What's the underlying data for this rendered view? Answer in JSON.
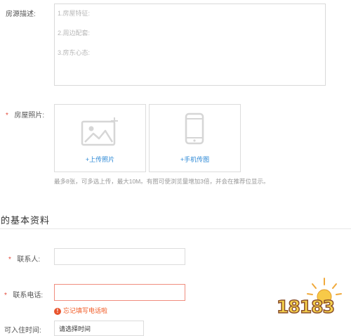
{
  "description": {
    "label": "房源描述:",
    "placeholder_lines": [
      "1.房屋特征:",
      "2.周边配套:",
      "3.房东心态:"
    ]
  },
  "photos": {
    "label": "房屋照片:",
    "upload_label": "+上传照片",
    "phone_label": "+手机传图",
    "hint": "最多8张，可多选上传，最大10M。有图可使浏览量增加3倍，并会在推荐位显示。"
  },
  "section": {
    "title": "的基本资料"
  },
  "contact": {
    "name_label": "联系人:",
    "phone_label": "联系电话:",
    "phone_error": "忘记填写电话啦",
    "movein_label": "可入住时间:",
    "movein_value": "请选择时间"
  },
  "watermark": {
    "text": "18183"
  },
  "colors": {
    "required": "#e34a3b",
    "link": "#2d89d6",
    "error": "#f15a24"
  }
}
